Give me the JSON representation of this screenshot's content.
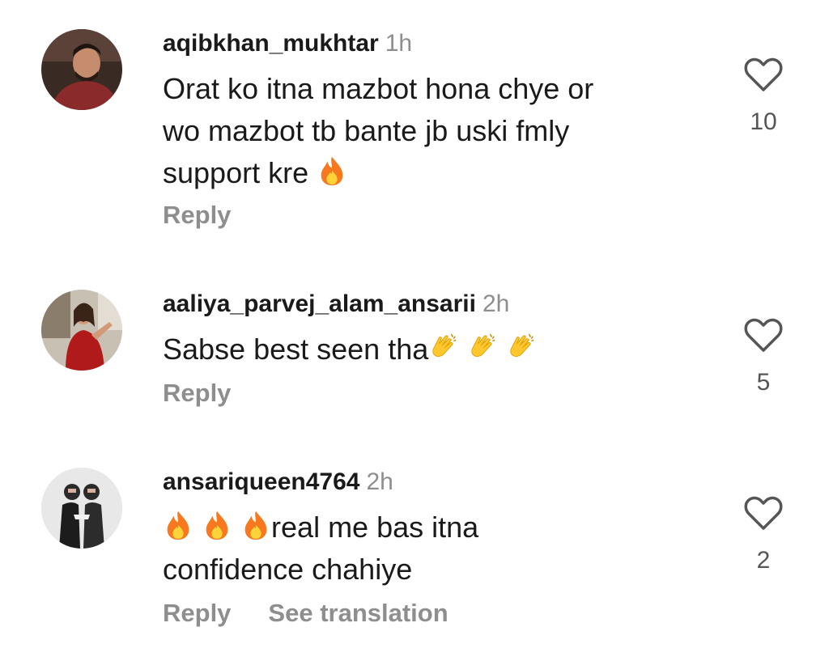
{
  "comments": [
    {
      "username": "aqibkhan_mukhtar",
      "time": "1h",
      "text_lines": [
        "Orat ko itna mazbot hona chye or",
        "wo mazbot tb bante jb uski fmly",
        "support kre"
      ],
      "emoji": "fire",
      "reply_label": "Reply",
      "likes": "10",
      "avatar_icon": "man-portrait-avatar"
    },
    {
      "username": "aaliya_parvej_alam_ansarii",
      "time": "2h",
      "text": "Sabse best seen tha",
      "emoji_after": [
        "clapping-hands",
        "clapping-hands",
        "clapping-hands"
      ],
      "reply_label": "Reply",
      "likes": "5",
      "avatar_icon": "woman-red-dress-avatar"
    },
    {
      "username": "ansariqueen4764",
      "time": "2h",
      "emoji_before": [
        "fire",
        "fire",
        "fire"
      ],
      "text_line1": "real me bas itna",
      "text_line2": "confidence chahiye",
      "reply_label": "Reply",
      "translation_label": "See translation",
      "likes": "2",
      "avatar_icon": "two-people-avatar"
    }
  ],
  "colors": {
    "username": "#1a1a1a",
    "secondary_text": "#8e8e8e",
    "like_outline": "#555555",
    "fire_orange": "#f7781e",
    "fire_yellow": "#ffd23a",
    "clap_yellow": "#ffc72c"
  }
}
